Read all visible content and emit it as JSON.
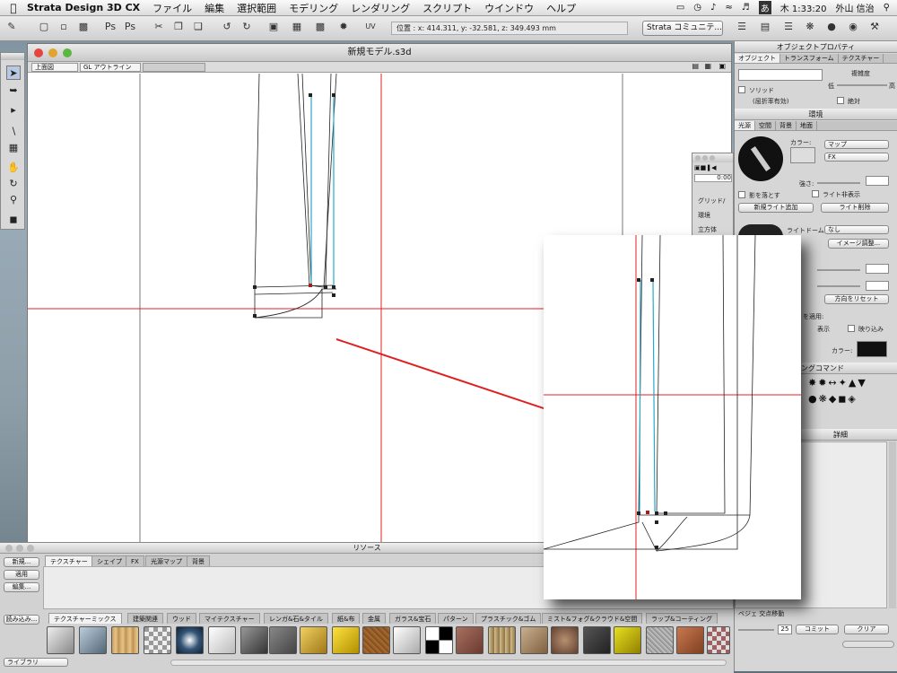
{
  "menubar": {
    "app_name": "Strata Design 3D CX",
    "items": [
      "ファイル",
      "編集",
      "選択範囲",
      "モデリング",
      "レンダリング",
      "スクリプト",
      "ウインドウ",
      "ヘルプ"
    ],
    "input_mode": "あ",
    "clock": "木 1:33:20",
    "user": "外山 信治"
  },
  "toolbar": {
    "coordinates": "位置 : x: 414.311, y: -32.581, z: 349.493 mm",
    "community_select": "Strata コミュニテ..."
  },
  "main_window": {
    "title": "新規モデル.s3d",
    "view_select": "上面図",
    "render_select": "GL アウトライン"
  },
  "object_properties": {
    "title": "オブジェクトプロパティ",
    "tabs": [
      "オブジェクト",
      "トランスフォーム",
      "テクスチャー"
    ],
    "complexity_label": "複雑度",
    "low": "低",
    "high": "高",
    "solid_label": "ソリッド",
    "refraction_label": "(屈折率有効)",
    "absolute_label": "絶対"
  },
  "environment": {
    "title": "環境",
    "tabs": [
      "光源",
      "空間",
      "背景",
      "地面"
    ],
    "color_label": "カラー:",
    "map_select": "マップ",
    "fx_select": "FX",
    "intensity_label": "強さ:",
    "cast_shadow": "影を落とす",
    "light_hide": "ライト非表示",
    "add_light": "新規ライト追加",
    "delete_light": "ライト削除",
    "light_dome_label": "ライトドーム:",
    "light_dome_value": "なし",
    "image_adjust": "イメージ調整...",
    "reset_direction": "方向をリセット",
    "apply_label": "を適用:",
    "display_label": "表示",
    "reflect_label": "映り込み",
    "color2_label": "カラー:"
  },
  "modeling_cmd": {
    "title": "ングコマンド"
  },
  "details": {
    "title": "詳細",
    "bezier_label": "ベジェ 交点移動",
    "value": "25",
    "commit": "コミット",
    "clear": "クリア"
  },
  "anim_palette": {
    "time": "0:00",
    "items": [
      "グリッド/",
      "環境",
      "立方体"
    ]
  },
  "resources": {
    "title": "リソース",
    "buttons": [
      "新規...",
      "適用",
      "編集...",
      "読み込み..."
    ],
    "library_label": "ライブラリ",
    "top_tabs": [
      "テクスチャー",
      "シェイプ",
      "FX",
      "光源マップ",
      "背景"
    ],
    "bottom_tabs": [
      "テクスチャーミックス",
      "建築関連",
      "ウッド",
      "マイテクスチャー",
      "レンガ&石&タイル",
      "紙&布",
      "金属",
      "ガラス&宝石",
      "パターン",
      "プラスチック&ゴム",
      "ミスト&フォグ&クラウド&空間",
      "ラップ&コーティング"
    ]
  },
  "colors": {
    "axis_red": "#e02020",
    "cyan_edge": "#2aa8c8",
    "arrow_red": "#e02020"
  },
  "icons": [
    "apple-icon",
    "save-icon",
    "scissors-icon",
    "undo-icon",
    "redo-icon",
    "arrow-select-icon",
    "hand-icon",
    "magnifier-icon",
    "spotlight-icon"
  ]
}
